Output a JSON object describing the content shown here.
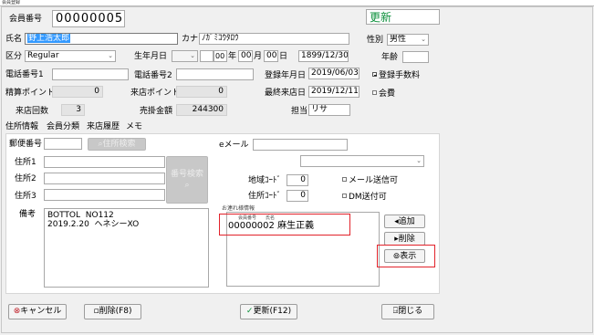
{
  "window": {
    "title": "会員登録"
  },
  "header": {
    "member_no_label": "会員番号",
    "member_no": "00000005",
    "mode_value": "更新"
  },
  "row1": {
    "name_label": "氏名",
    "name_value": "野上浩太郎",
    "kana_label": "カナ",
    "kana_value": "ﾉｶﾞﾐｺｳﾀﾛｳ",
    "gender_label": "性別",
    "gender_value": "男性"
  },
  "row2": {
    "category_label": "区分",
    "category_value": "Regular",
    "birthdate_label": "生年月日",
    "birth_year": "",
    "birth_month": "00",
    "birth_day": "00",
    "unit_year": "年",
    "unit_month": "月",
    "unit_day": "日",
    "birth_full": "1899/12/30",
    "age_label": "年齢",
    "age_value": ""
  },
  "row3": {
    "phone1_label": "電話番号1",
    "phone1_value": "",
    "phone2_label": "電話番号2",
    "phone2_value": "",
    "reg_date_label": "登録年月日",
    "reg_date_value": "2019/06/03",
    "reg_fee_label": "登録手数料"
  },
  "row4": {
    "points_label": "精算ポイント",
    "points_value": "0",
    "visit_points_label": "来店ポイント",
    "visit_points_value": "0",
    "last_visit_label": "最終来店日",
    "last_visit_value": "2019/12/11",
    "membership_fee_label": "会費"
  },
  "row5": {
    "visits_label": "来店回数",
    "visits_value": "3",
    "sales_label": "売掛金額",
    "sales_value": "244300",
    "staff_label": "担当",
    "staff_value": "リサ"
  },
  "tabs": [
    "住所情報",
    "会員分類",
    "来店履歴",
    "メモ"
  ],
  "address": {
    "postal_label": "郵便番号",
    "postal_value": "",
    "address_search_button": "住所検索",
    "address1_label": "住所1",
    "address1_value": "",
    "address2_label": "住所2",
    "address2_value": "",
    "address3_label": "住所3",
    "address3_value": "",
    "postal_search_button": "番号検索",
    "email_label": "eメール",
    "email_value": "",
    "region_code_label": "地域ｺｰﾄﾞ",
    "region_code_value": "0",
    "address_code_label": "住所ｺｰﾄﾞ",
    "address_code_value": "0",
    "mail_send_label": "メール送信可",
    "dm_send_label": "DM送付可",
    "notes_label": "備考",
    "notes_value": "BOTTOL  NO112\n2019.2.20  ヘネシーXO"
  },
  "companions": {
    "label": "お連れ様情報",
    "col_no": "会員番号",
    "col_name": "氏名",
    "rows": [
      {
        "no": "00000002",
        "name": "麻生正義"
      }
    ],
    "add_button": "追加",
    "delete_button": "削除",
    "show_button": "表示"
  },
  "footer": {
    "cancel_button": "キャンセル",
    "delete_button": "削除(F8)",
    "update_button": "更新(F12)",
    "close_button": "閉じる"
  },
  "colors": {
    "update_text": "#0c8f3b",
    "highlight_box": "#e2222a",
    "selection": "#3399ff"
  }
}
